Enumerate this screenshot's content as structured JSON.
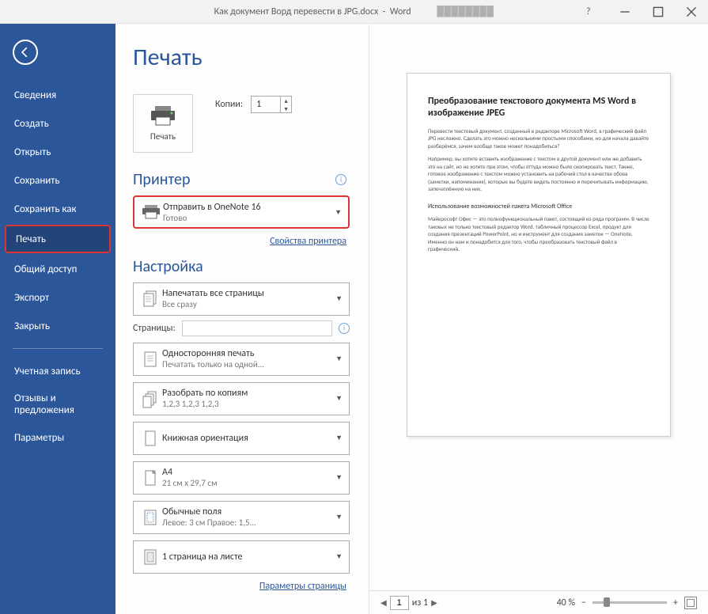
{
  "titlebar": {
    "doc": "Как документ Ворд перевести в JPG.docx",
    "app": "Word"
  },
  "sidebar": {
    "items": [
      {
        "label": "Сведения"
      },
      {
        "label": "Создать"
      },
      {
        "label": "Открыть"
      },
      {
        "label": "Сохранить"
      },
      {
        "label": "Сохранить как"
      },
      {
        "label": "Печать"
      },
      {
        "label": "Общий доступ"
      },
      {
        "label": "Экспорт"
      },
      {
        "label": "Закрыть"
      },
      {
        "label": "Учетная запись"
      },
      {
        "label": "Отзывы и предложения"
      },
      {
        "label": "Параметры"
      }
    ]
  },
  "print": {
    "heading": "Печать",
    "button": "Печать",
    "copies_label": "Копии:",
    "copies_value": "1",
    "printer_heading": "Принтер",
    "printer_name": "Отправить в OneNote 16",
    "printer_status": "Готово",
    "printer_props": "Свойства принтера",
    "settings_heading": "Настройка",
    "opt_allpages": "Напечатать все страницы",
    "opt_allpages_sub": "Все сразу",
    "pages_label": "Страницы:",
    "opt_oneside": "Односторонняя печать",
    "opt_oneside_sub": "Печатать только на одной...",
    "opt_collate": "Разобрать по копиям",
    "opt_collate_sub": "1,2,3   1,2,3   1,2,3",
    "opt_orient": "Книжная ориентация",
    "opt_size": "A4",
    "opt_size_sub": "21 см x 29,7 см",
    "opt_margins": "Обычные поля",
    "opt_margins_sub": "Левое:  3 см   Правое:  1,5...",
    "opt_sheets": "1 страница на листе",
    "page_params": "Параметры страницы"
  },
  "preview": {
    "title": "Преобразование текстового документа MS Word в изображение JPEG",
    "p1": "Перевести текстовый документ, созданный в редакторе Microsoft Word, в графический файл JPG несложно. Сделать это можно несколькими простыми способами, но для начала давайте разберёмся, зачем вообще такое может понадобиться?",
    "p2": "Например, вы хотите вставить изображение с текстом в другой документ или же добавить это на сайт, но не хотите при этом, чтобы оттуда можно было скопировать текст. Также, готовое изображение с текстом можно установить на рабочий стол в качестве обоев (заметки, напоминания), которые вы будете видеть постоянно и перечитывать информацию, запечатлённую на них.",
    "sub": "Использование возможностей пакета Microsoft Office",
    "p3": "Майкрософт Офис — это полнофункциональный пакет, состоящий из ряда программ. В числе таковых не только текстовый редактор Word, табличный процессор Excel, продукт для создания презентаций PowerPoint, но и инструмент для создания заметок — OneNote. Именно он нам и понадобится для того, чтобы преобразовать текстовый файл в графический."
  },
  "status": {
    "page": "1",
    "of": "из 1",
    "zoom": "40 %"
  }
}
